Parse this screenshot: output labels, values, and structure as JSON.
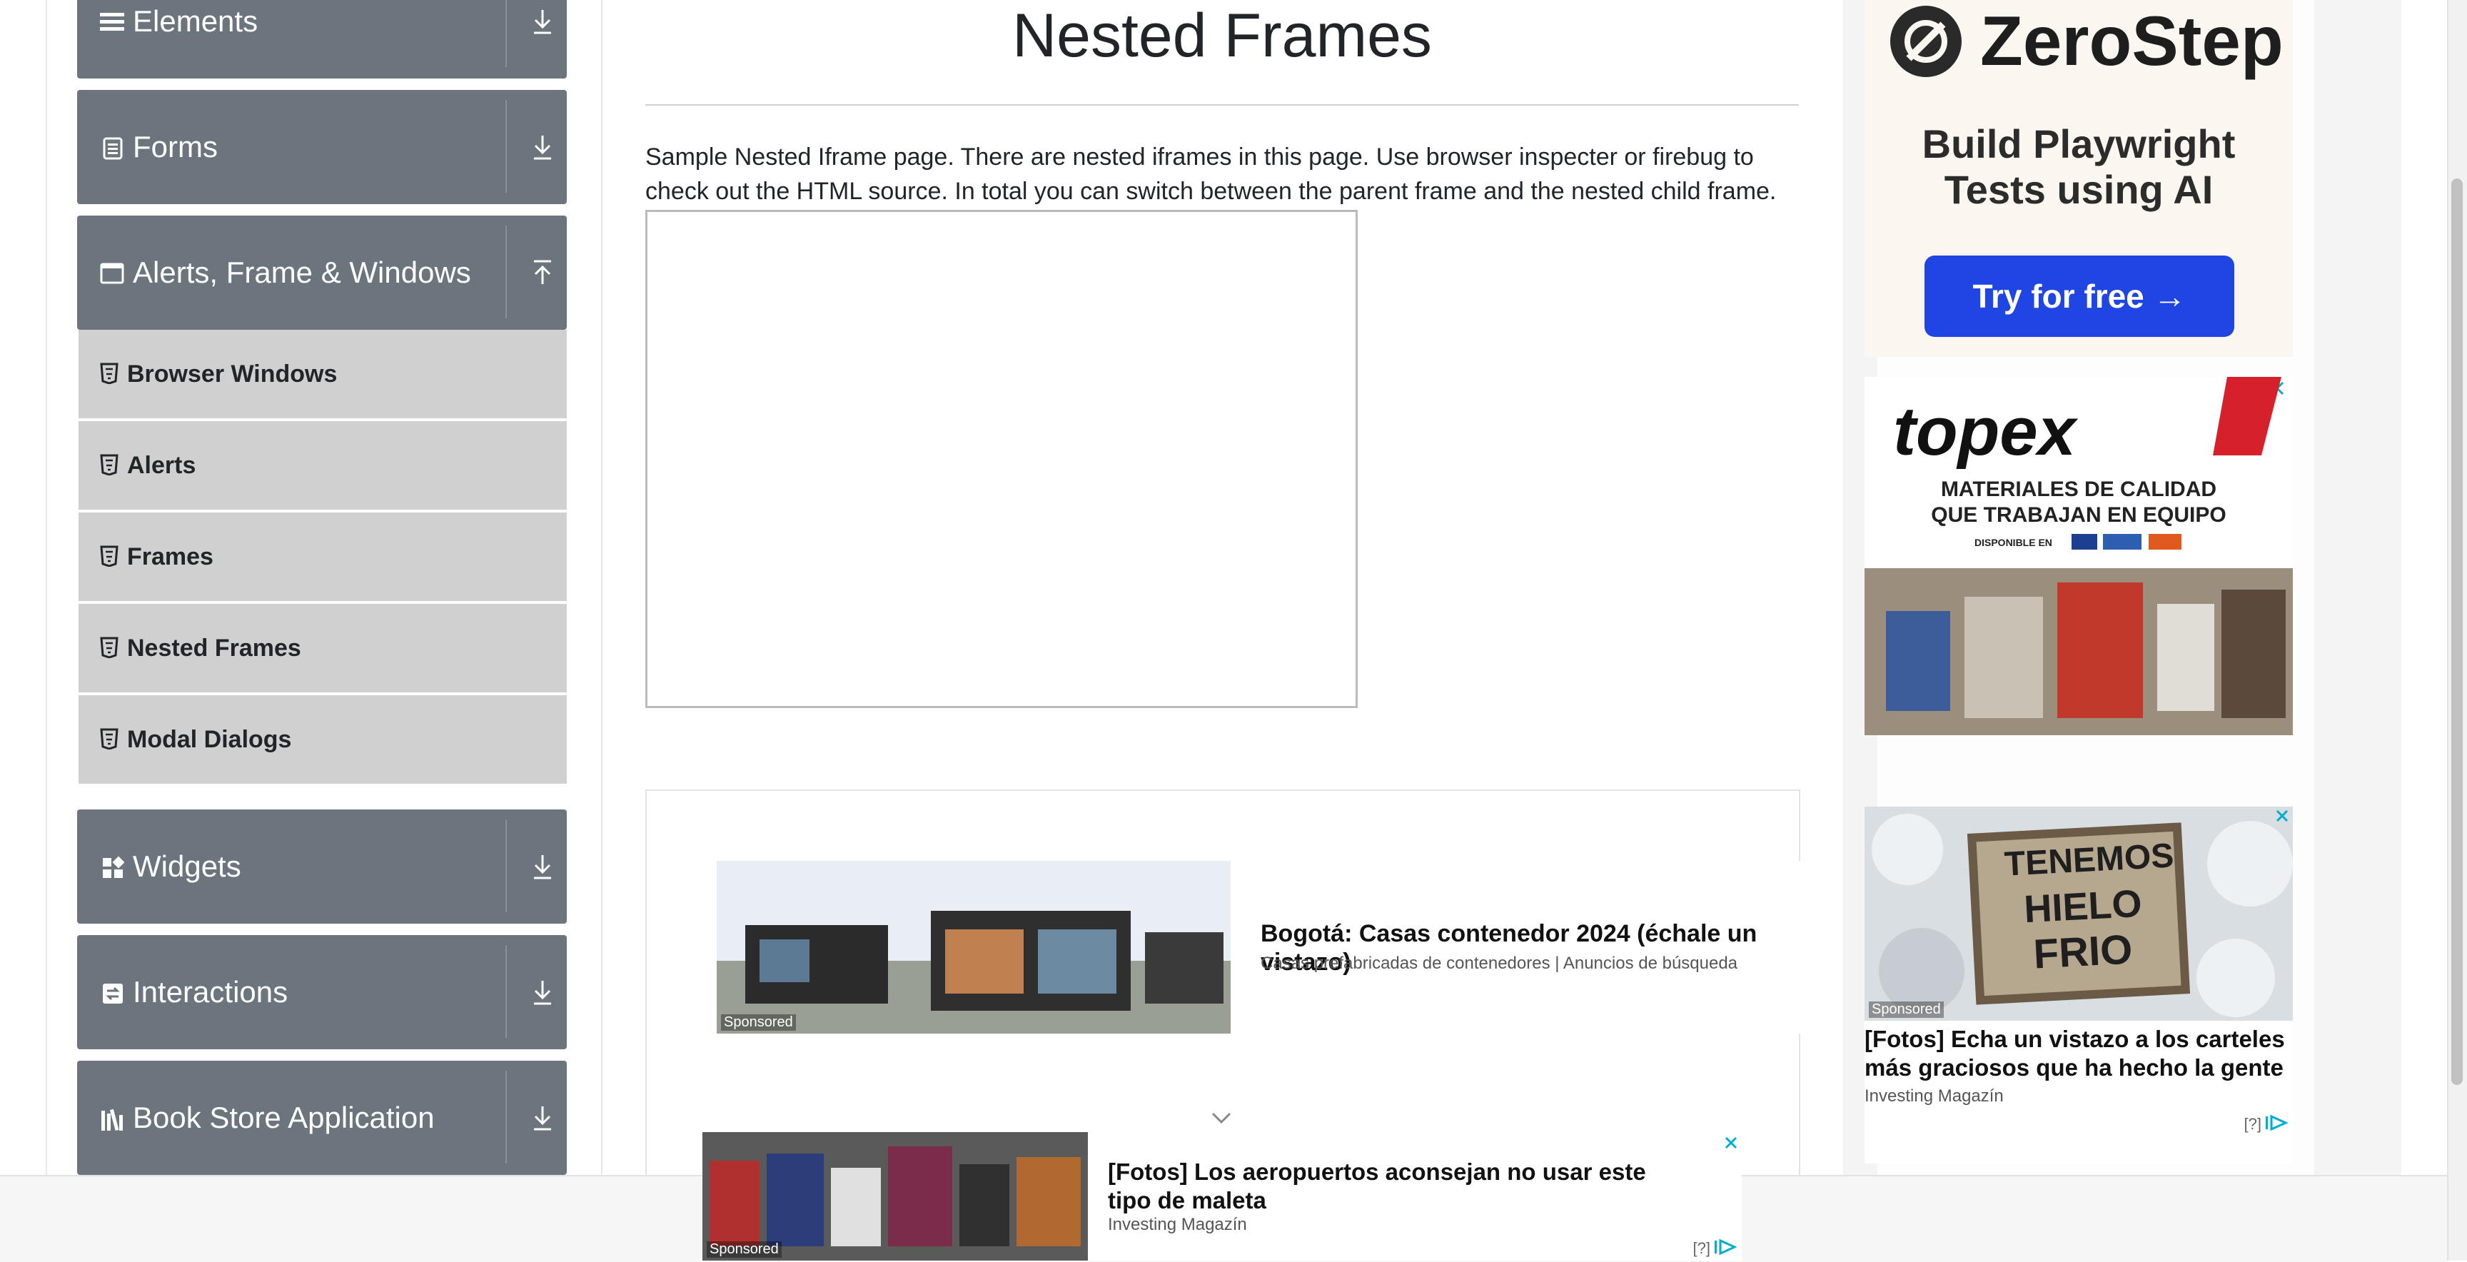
{
  "sidebar": {
    "groups": {
      "elements": "Elements",
      "forms": "Forms",
      "alerts": "Alerts, Frame & Windows",
      "widgets": "Widgets",
      "interactions": "Interactions",
      "bookstore": "Book Store Application"
    },
    "items": [
      "Browser Windows",
      "Alerts",
      "Frames",
      "Nested Frames",
      "Modal Dialogs"
    ]
  },
  "main": {
    "title": "Nested Frames",
    "description": "Sample Nested Iframe page. There are nested iframes in this page. Use browser inspecter or firebug to check out the HTML source. In total you can switch between the parent frame and the nested child frame."
  },
  "ads": {
    "center_top": {
      "headline": "Bogotá: Casas contenedor 2024 (échale un vistazo)",
      "source": "Casas prefabricadas de contenedores | Anuncios de búsqueda",
      "sponsored": "Sponsored"
    },
    "bottom": {
      "headline": "[Fotos] Los aeropuertos aconsejan no usar este tipo de maleta",
      "source": "Investing Magazín",
      "sponsored": "Sponsored",
      "help": "[?]"
    },
    "zerostep": {
      "brand": "ZeroStep",
      "line1": "Build Playwright",
      "line2": "Tests using AI",
      "cta": "Try for free →"
    },
    "topex": {
      "brand": "topex",
      "line1": "MATERIALES DE CALIDAD",
      "line2": "QUE TRABAJAN EN EQUIPO",
      "line3": "DISPONIBLE EN"
    },
    "hielo": {
      "sign1": "TENEMOS",
      "sign2": "HIELO",
      "sign3": "FRIO",
      "sponsored": "Sponsored",
      "headline": "[Fotos] Echa un vistazo a los carteles más graciosos que ha hecho la gente",
      "source": "Investing Magazín",
      "help": "[?]"
    }
  },
  "colors": {
    "group_bg": "#6c757d",
    "subitem_bg": "#d0d0d0",
    "cta_blue": "#1f45e3"
  }
}
